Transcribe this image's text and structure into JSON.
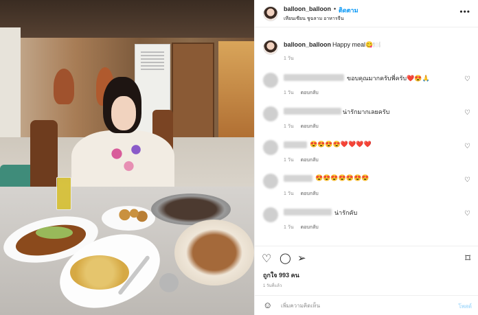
{
  "post_header": {
    "username": "balloon_balloon",
    "follow_label": "ติดตาม",
    "location": "เหียนเซียน ชูฉลาม อาหารจีน",
    "more_icon": "ellipsis-icon"
  },
  "caption": {
    "username": "balloon_balloon",
    "text": "Happy meal😋🍽️",
    "time": "1 วัน"
  },
  "comments": [
    {
      "text": "ขอบคุณมากครับพี่ครับ❤️😍🙏",
      "time": "1 วัน",
      "reply": "ตอบกลับ"
    },
    {
      "text": "น่ารักมากเลยครับ",
      "time": "1 วัน",
      "reply": "ตอบกลับ"
    },
    {
      "text": "😍😍😍😍❤️❤️❤️❤️",
      "time": "1 วัน",
      "reply": "ตอบกลับ"
    },
    {
      "text": "😍😍😍😍😍😍😍",
      "time": "1 วัน",
      "reply": "ตอบกลับ"
    },
    {
      "text": "น่ารักคับ",
      "time": "1 วัน",
      "reply": "ตอบกลับ"
    }
  ],
  "actions": {
    "likes_label": "ถูกใจ 993 คน",
    "post_time": "1 วันที่แล้ว"
  },
  "comment_box": {
    "placeholder": "เพิ่มความคิดเห็น",
    "post_label": "โพสต์"
  },
  "colors": {
    "follow_blue": "#0095f6",
    "text": "#262626",
    "muted": "#8e8e8e"
  }
}
